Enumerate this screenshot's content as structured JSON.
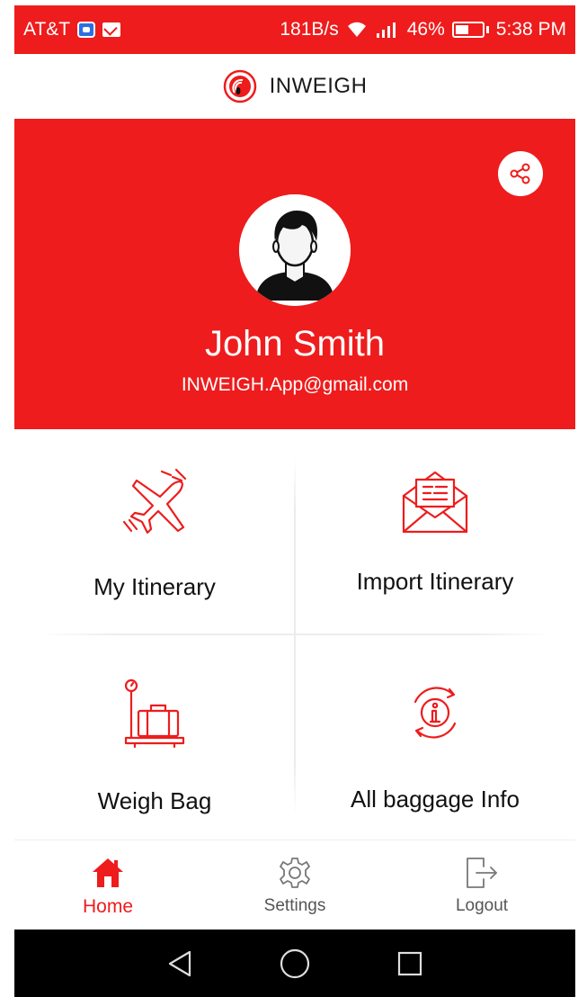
{
  "status_bar": {
    "carrier": "AT&T",
    "net_speed": "181B/s",
    "battery_percent": "46%",
    "time": "5:38 PM"
  },
  "header": {
    "app_title": "INWEIGH"
  },
  "profile": {
    "name": "John Smith",
    "email": "INWEIGH.App@gmail.com"
  },
  "menu_tiles": [
    {
      "label": "My Itinerary",
      "icon": "airplane-icon"
    },
    {
      "label": "Import Itinerary",
      "icon": "envelope-icon"
    },
    {
      "label": "Weigh Bag",
      "icon": "scale-luggage-icon"
    },
    {
      "label": "All baggage Info",
      "icon": "info-icon"
    }
  ],
  "bottom_nav": {
    "items": [
      {
        "label": "Home",
        "icon": "home-icon",
        "active": true
      },
      {
        "label": "Settings",
        "icon": "gear-icon",
        "active": false
      },
      {
        "label": "Logout",
        "icon": "logout-icon",
        "active": false
      }
    ]
  },
  "colors": {
    "accent": "#ee1c1c",
    "text": "#111111",
    "muted": "#555555"
  }
}
